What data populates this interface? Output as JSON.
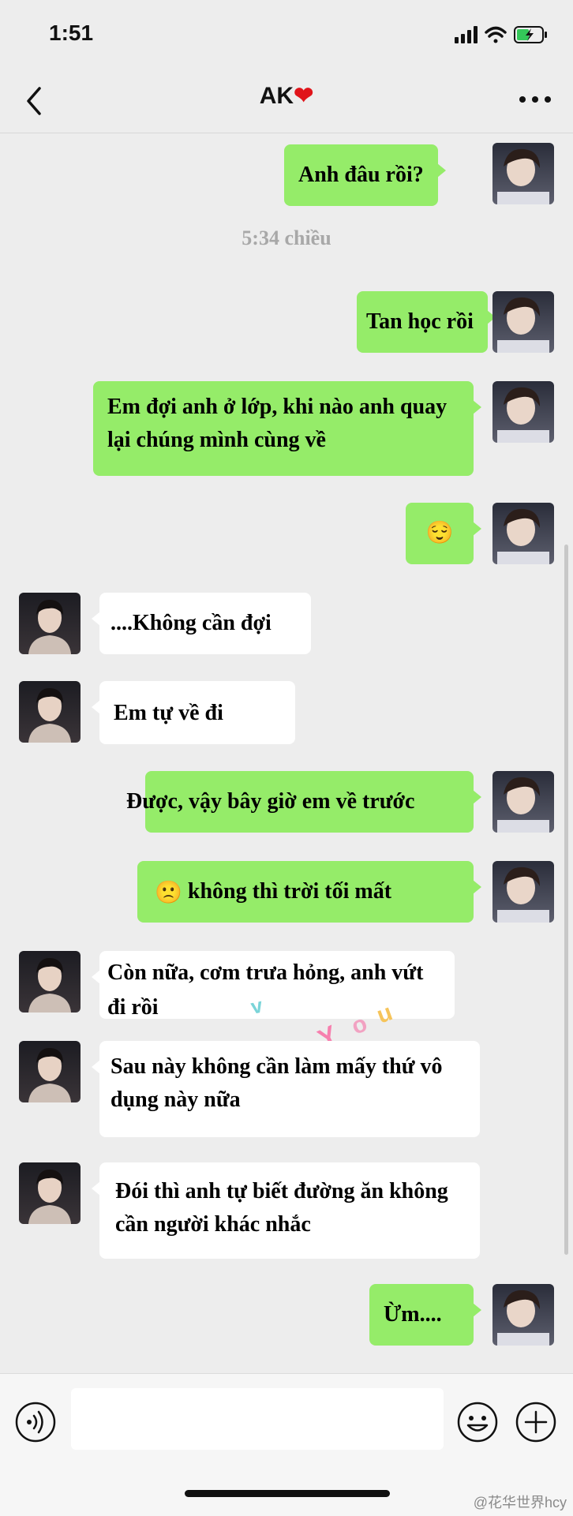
{
  "status": {
    "time": "1:51"
  },
  "header": {
    "title": "AK",
    "title_emoji": "❤"
  },
  "messages": [
    {
      "text": "Anh đâu rồi?"
    },
    {
      "text": "Tan học rồi"
    },
    {
      "text": "Em đợi anh ở lớp, khi nào anh quay lại chúng mình cùng về"
    },
    {
      "emoji": "😌"
    },
    {
      "text": "....Không cần đợi"
    },
    {
      "text": "Em tự về đi"
    },
    {
      "text": "Được, vậy bây giờ em về trước"
    },
    {
      "emoji": "🙁",
      "text": "không thì trời tối mất"
    },
    {
      "text": "Còn nữa, cơm trưa hỏng, anh vứt đi rồi"
    },
    {
      "text": "Sau này không cần làm mấy thứ vô dụng này nữa"
    },
    {
      "text": "Đói thì anh tự biết đường ăn không cần người khác nhắc"
    },
    {
      "text": "Ừm...."
    }
  ],
  "timestamp": "5:34 chiều",
  "watermark": "@花华世界hcy",
  "colors": {
    "my_bubble": "#95ec69",
    "their_bubble": "#ffffff",
    "background": "#ededed"
  }
}
